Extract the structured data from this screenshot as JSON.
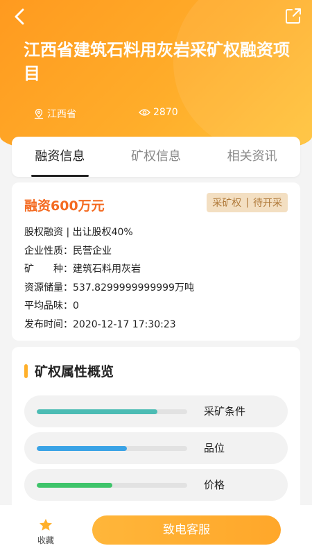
{
  "header": {
    "title": "江西省建筑石料用灰岩采矿权融资项目",
    "location": "江西省",
    "views": "2870"
  },
  "tabs": [
    {
      "label": "融资信息",
      "active": true
    },
    {
      "label": "矿权信息",
      "active": false
    },
    {
      "label": "相关资讯",
      "active": false
    }
  ],
  "finance": {
    "amount": "融资600万元",
    "badge_left": "采矿权",
    "badge_right": "待开采",
    "lines": [
      {
        "label": "",
        "value": "股权融资 | 出让股权40%"
      },
      {
        "label": "企业性质：",
        "value": "民营企业"
      },
      {
        "label": "矿　　种：",
        "value": "建筑石料用灰岩"
      },
      {
        "label": "资源储量：",
        "value": "537.8299999999999万吨"
      },
      {
        "label": "平均品味：",
        "value": "0"
      },
      {
        "label": "发布时间：",
        "value": "2020-12-17 17:30:23"
      }
    ]
  },
  "properties": {
    "title": "矿权属性概览",
    "items": [
      {
        "label": "采矿条件",
        "level": 0.8,
        "color": "#4cbcb4"
      },
      {
        "label": "品位",
        "level": 0.6,
        "color": "#3aa3e6"
      },
      {
        "label": "价格",
        "level": 0.5,
        "color": "#3ec46a"
      }
    ]
  },
  "bottom": {
    "favorite_label": "收藏",
    "call_label": "致电客服"
  },
  "colors": {
    "accent": "#ffa726",
    "finance_red": "#f46b22",
    "star": "#ffb02a"
  }
}
